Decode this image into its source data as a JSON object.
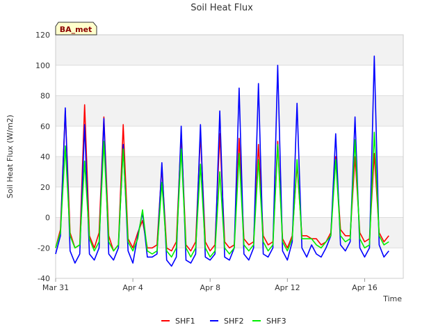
{
  "chart_data": {
    "type": "line",
    "title": "Soil Heat Flux",
    "xlabel": "Time",
    "ylabel": "Soil Heat Flux (W/m2)",
    "badge": "BA_met",
    "ylim": [
      -40,
      120
    ],
    "xlim": [
      0,
      18
    ],
    "y_ticks": [
      -40,
      -20,
      0,
      20,
      40,
      60,
      80,
      100,
      120
    ],
    "x_ticks": [
      {
        "day": 0,
        "label": "Mar 31"
      },
      {
        "day": 4,
        "label": "Apr 4"
      },
      {
        "day": 8,
        "label": "Apr 8"
      },
      {
        "day": 12,
        "label": "Apr 12"
      },
      {
        "day": 16,
        "label": "Apr 16"
      }
    ],
    "grid": true,
    "legend_position": "bottom",
    "series": [
      {
        "name": "SHF1",
        "color": "#ff0000"
      },
      {
        "name": "SHF2",
        "color": "#0000ff"
      },
      {
        "name": "SHF3",
        "color": "#00ee00"
      }
    ],
    "x_days": [
      0,
      0.25,
      0.5,
      0.75,
      1,
      1.25,
      1.5,
      1.75,
      2,
      2.25,
      2.5,
      2.75,
      3,
      3.25,
      3.5,
      3.75,
      4,
      4.25,
      4.5,
      4.75,
      5,
      5.25,
      5.5,
      5.75,
      6,
      6.25,
      6.5,
      6.75,
      7,
      7.25,
      7.5,
      7.75,
      8,
      8.25,
      8.5,
      8.75,
      9,
      9.25,
      9.5,
      9.75,
      10,
      10.25,
      10.5,
      10.75,
      11,
      11.25,
      11.5,
      11.75,
      12,
      12.25,
      12.5,
      12.75,
      13,
      13.25,
      13.5,
      13.75,
      14,
      14.25,
      14.5,
      14.75,
      15,
      15.25,
      15.5,
      15.75,
      16,
      16.25,
      16.5,
      16.75,
      17,
      17.25
    ],
    "values": {
      "SHF1": [
        -20,
        -8,
        70,
        -10,
        -20,
        -18,
        74,
        -12,
        -20,
        -10,
        66,
        -12,
        -22,
        -18,
        61,
        -14,
        -20,
        -10,
        -2,
        -20,
        -20,
        -18,
        33,
        -20,
        -22,
        -16,
        55,
        -18,
        -22,
        -16,
        55,
        -16,
        -22,
        -18,
        55,
        -16,
        -20,
        -18,
        52,
        -14,
        -18,
        -16,
        48,
        -12,
        -18,
        -16,
        50,
        -14,
        -20,
        -12,
        35,
        -12,
        -12,
        -14,
        -14,
        -18,
        -16,
        -10,
        40,
        -8,
        -12,
        -12,
        40,
        -10,
        -16,
        -14,
        42,
        -10,
        -16,
        -12
      ],
      "SHF2": [
        -24,
        -12,
        72,
        -22,
        -30,
        -24,
        61,
        -24,
        -28,
        -20,
        65,
        -24,
        -28,
        -20,
        48,
        -22,
        -30,
        -12,
        3,
        -26,
        -26,
        -24,
        36,
        -28,
        -32,
        -26,
        60,
        -28,
        -30,
        -24,
        61,
        -26,
        -28,
        -24,
        70,
        -26,
        -28,
        -20,
        85,
        -24,
        -28,
        -20,
        88,
        -24,
        -26,
        -20,
        100,
        -22,
        -28,
        -16,
        75,
        -20,
        -26,
        -18,
        -24,
        -26,
        -20,
        -12,
        55,
        -18,
        -22,
        -16,
        66,
        -20,
        -26,
        -20,
        106,
        -18,
        -26,
        -22
      ],
      "SHF3": [
        -20,
        -10,
        47,
        -12,
        -20,
        -18,
        37,
        -14,
        -22,
        -16,
        50,
        -16,
        -22,
        -18,
        45,
        -16,
        -22,
        -14,
        5,
        -22,
        -24,
        -22,
        23,
        -22,
        -26,
        -20,
        45,
        -20,
        -26,
        -20,
        35,
        -20,
        -26,
        -22,
        30,
        -20,
        -24,
        -20,
        42,
        -18,
        -22,
        -18,
        38,
        -16,
        -22,
        -18,
        48,
        -16,
        -22,
        -14,
        38,
        -14,
        -14,
        -14,
        -18,
        -20,
        -16,
        -12,
        38,
        -12,
        -16,
        -14,
        51,
        -14,
        -20,
        -18,
        56,
        -12,
        -18,
        -16
      ]
    }
  }
}
